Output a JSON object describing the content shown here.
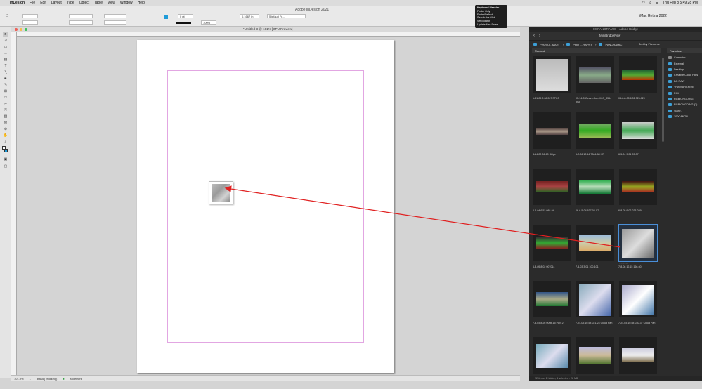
{
  "menubar": {
    "app": "InDesign",
    "items": [
      "File",
      "Edit",
      "Layout",
      "Type",
      "Object",
      "Table",
      "View",
      "Window",
      "Help"
    ],
    "clock": "Thu Feb 8  5:49:28 PM"
  },
  "control": {
    "window_title": "Adobe InDesign 2021",
    "stroke_weight": "0 pt",
    "zoom": "100%",
    "dimension": "0.1667 in",
    "style": "[Default Fr...",
    "workspace": "iMac Retina 2022"
  },
  "keyboard_maestro": {
    "title": "Keyboard Maestro",
    "items": [
      "Finder Only",
      "Finder/Default",
      "Search the Web",
      "Set Monitor",
      "Update Mac Sales"
    ]
  },
  "document": {
    "tab_title": "*Untitled-3 @ 101% [GPU Preview]"
  },
  "status": {
    "zoom": "101.9%",
    "page": "1",
    "style": "[Basic] (working)",
    "preflight": "No errors"
  },
  "bridge": {
    "title": "00 PANORAMIC - Adobe Bridge",
    "workspace": "MiniBridgeNew",
    "path": [
      "PHOTO...& ART",
      "PHOT...RAPHY",
      "PANORAMIC"
    ],
    "sort": "Sort by Filename",
    "content_tab": "Content",
    "favorites_tab": "Favorites",
    "favorites": [
      "Computer",
      "External",
      "Desktop",
      "Creative Cloud Files",
      "BG RAW",
      "+RAW ARCHIVE",
      "P44",
      "RGB ONGOING",
      "RGB ONGOING (2)",
      "Stanz.",
      "100CANON"
    ],
    "thumbs": [
      {
        "caption": "1-31-05 2.08.007 STOP"
      },
      {
        "caption": "05-14-20BeaverDam IMG_3564 .psd"
      },
      {
        "caption": "04-8-8-05 6.02 025-029"
      },
      {
        "caption": "4-14-00 06-60 Stripe"
      },
      {
        "caption": "6-2-06 12.44 7084-88 HR"
      },
      {
        "caption": "6-5-04 9.01 03-07"
      },
      {
        "caption": "6-6-04 6.53 088-94"
      },
      {
        "caption": "06-6-5-04 637-03-07"
      },
      {
        "caption": "6-8-05 9.02 023-029"
      },
      {
        "caption": "6-8-05 8.02 007014"
      },
      {
        "caption": "7-4-03 3.01 100-101"
      },
      {
        "caption": "7-8-08 12.15 166-60"
      },
      {
        "caption": "7-8-03 8.26 0008-15 PAN 2"
      },
      {
        "caption": "7-24-03 10.58 021-24 Cloud Pan"
      },
      {
        "caption": "7-24-03 10.58 030-37 Cloud Pan"
      },
      {
        "caption": ""
      },
      {
        "caption": ""
      },
      {
        "caption": ""
      }
    ],
    "status": "22 items, 1 hidden, 1 selected - 28 MB"
  }
}
